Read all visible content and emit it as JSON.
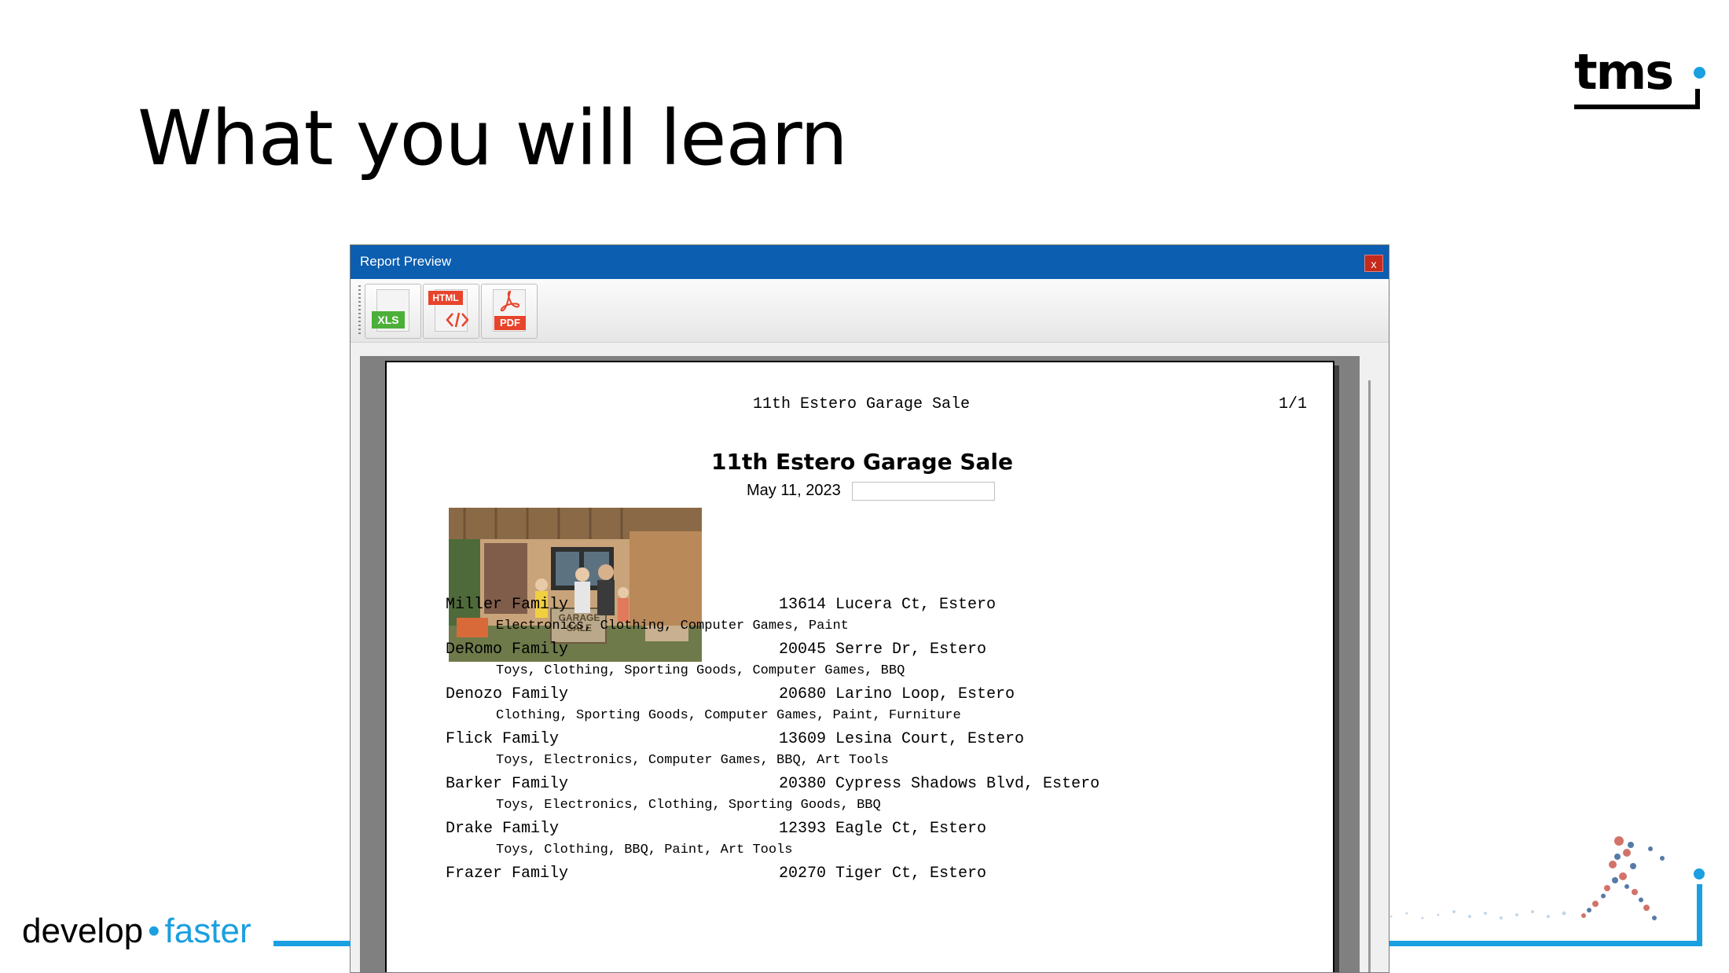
{
  "slide": {
    "title": "What you will learn",
    "logo_text": "tms",
    "brand_develop": "develop",
    "brand_dot": "•",
    "brand_faster": "faster"
  },
  "window": {
    "title": "Report Preview",
    "close_label": "x",
    "toolbar": [
      {
        "name": "export-xls-button",
        "label": "XLS",
        "color": "#4caf3a"
      },
      {
        "name": "export-html-button",
        "label": "HTML",
        "color": "#e8432b"
      },
      {
        "name": "export-pdf-button",
        "label": "PDF",
        "color": "#e8432b"
      }
    ]
  },
  "report": {
    "header_title": "11th Estero Garage Sale",
    "page_indicator": "1/1",
    "title": "11th Estero Garage Sale",
    "date": "May 11, 2023",
    "photo_caption": "GARAGE SALE",
    "entries": [
      {
        "family": "Miller Family",
        "address": "13614 Lucera Ct, Estero",
        "items": "Electronics, Clothing, Computer Games, Paint"
      },
      {
        "family": "DeRomo Family",
        "address": "20045 Serre Dr, Estero",
        "items": "Toys, Clothing, Sporting Goods, Computer Games, BBQ"
      },
      {
        "family": "Denozo Family",
        "address": "20680 Larino Loop, Estero",
        "items": "Clothing, Sporting Goods, Computer Games, Paint, Furniture"
      },
      {
        "family": "Flick Family",
        "address": "13609 Lesina Court, Estero",
        "items": "Toys, Electronics, Computer Games, BBQ, Art Tools"
      },
      {
        "family": "Barker Family",
        "address": "20380 Cypress Shadows Blvd, Estero",
        "items": "Toys, Electronics, Clothing, Sporting Goods, BBQ"
      },
      {
        "family": "Drake Family",
        "address": "12393 Eagle Ct, Estero",
        "items": "Toys, Clothing, BBQ, Paint, Art Tools"
      },
      {
        "family": "Frazer Family",
        "address": "20270 Tiger Ct, Estero",
        "items": ""
      }
    ]
  }
}
